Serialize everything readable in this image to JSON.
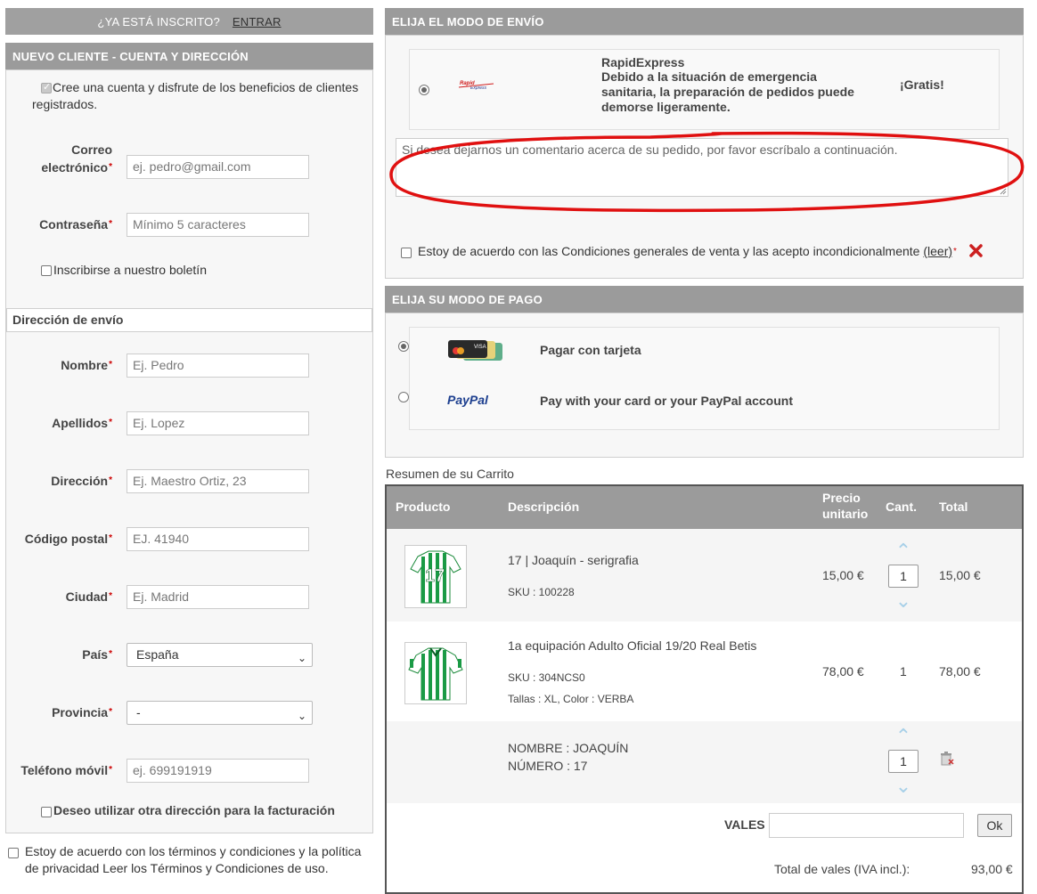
{
  "login_bar": {
    "question": "¿YA ESTÁ INSCRITO?",
    "link": "ENTRAR"
  },
  "new_client": {
    "title": "NUEVO CLIENTE - CUENTA Y DIRECCIÓN",
    "create_account": "Cree una cuenta y disfrute de los beneficios de clientes registrados.",
    "email_label": "Correo electrónico",
    "email_placeholder": "ej. pedro@gmail.com",
    "password_label": "Contraseña",
    "password_placeholder": "Mínimo 5 caracteres",
    "newsletter": "Inscribirse a nuestro boletín"
  },
  "shipping_address": {
    "title": "Dirección de envío",
    "name_label": "Nombre",
    "name_placeholder": "Ej. Pedro",
    "surname_label": "Apellidos",
    "surname_placeholder": "Ej. Lopez",
    "address_label": "Dirección",
    "address_placeholder": "Ej. Maestro Ortiz, 23",
    "zip_label": "Código postal",
    "zip_placeholder": "EJ. 41940",
    "city_label": "Ciudad",
    "city_placeholder": "Ej. Madrid",
    "country_label": "País",
    "country_value": "España",
    "province_label": "Provincia",
    "province_value": "-",
    "phone_label": "Teléfono móvil",
    "phone_placeholder": "ej. 699191919",
    "billing_other": "Deseo utilizar otra dirección para la facturación"
  },
  "terms_left": "Estoy de acuerdo con los términos y condiciones y la política de privacidad Leer los Términos y Condiciones de uso.",
  "shipping": {
    "title": "ELIJA EL MODO DE ENVÍO",
    "carrier_name": "RapidExpress",
    "carrier_desc": "Debido a la situación de emergencia sanitaria, la preparación de pedidos puede demorse ligeramente.",
    "price": "¡Gratis!",
    "comment_placeholder": "Si desea dejarnos un comentario acerca de su pedido, por favor escríbalo a continuación.",
    "terms": "Estoy de acuerdo con las Condiciones generales de venta y las acepto incondicionalmente",
    "terms_link": "(leer)"
  },
  "payment": {
    "title": "ELIJA SU MODO DE PAGO",
    "card": "Pagar con tarjeta",
    "paypal_logo": "PayPal",
    "paypal": "Pay with your card or your PayPal account"
  },
  "cart": {
    "caption": "Resumen de su Carrito",
    "headers": {
      "product": "Producto",
      "description": "Descripción",
      "price_line1": "Precio",
      "price_line2": "unitario",
      "qty": "Cant.",
      "total": "Total"
    },
    "items": [
      {
        "name": "17 | Joaquín - serigrafia",
        "sku": "SKU : 100228",
        "price": "15,00 €",
        "qty": "1",
        "total": "15,00 €"
      },
      {
        "name": "1a equipación Adulto Oficial 19/20 Real Betis",
        "sku": "SKU : 304NCS0",
        "attrs": "Tallas : XL, Color : VERBA",
        "price": "78,00 €",
        "qty": "1",
        "total": "78,00 €"
      }
    ],
    "custom": {
      "name": "NOMBRE : JOAQUÍN",
      "number": "NÚMERO : 17",
      "qty": "1"
    },
    "vales_label": "VALES",
    "ok": "Ok",
    "total_label": "Total de vales (IVA incl.):",
    "total_value": "93,00 €"
  },
  "colors": {
    "header_gray": "#9b9b9b",
    "required_red": "#cc0000",
    "annotation_red": "#e01010",
    "paypal_blue": "#1d3f8f"
  }
}
